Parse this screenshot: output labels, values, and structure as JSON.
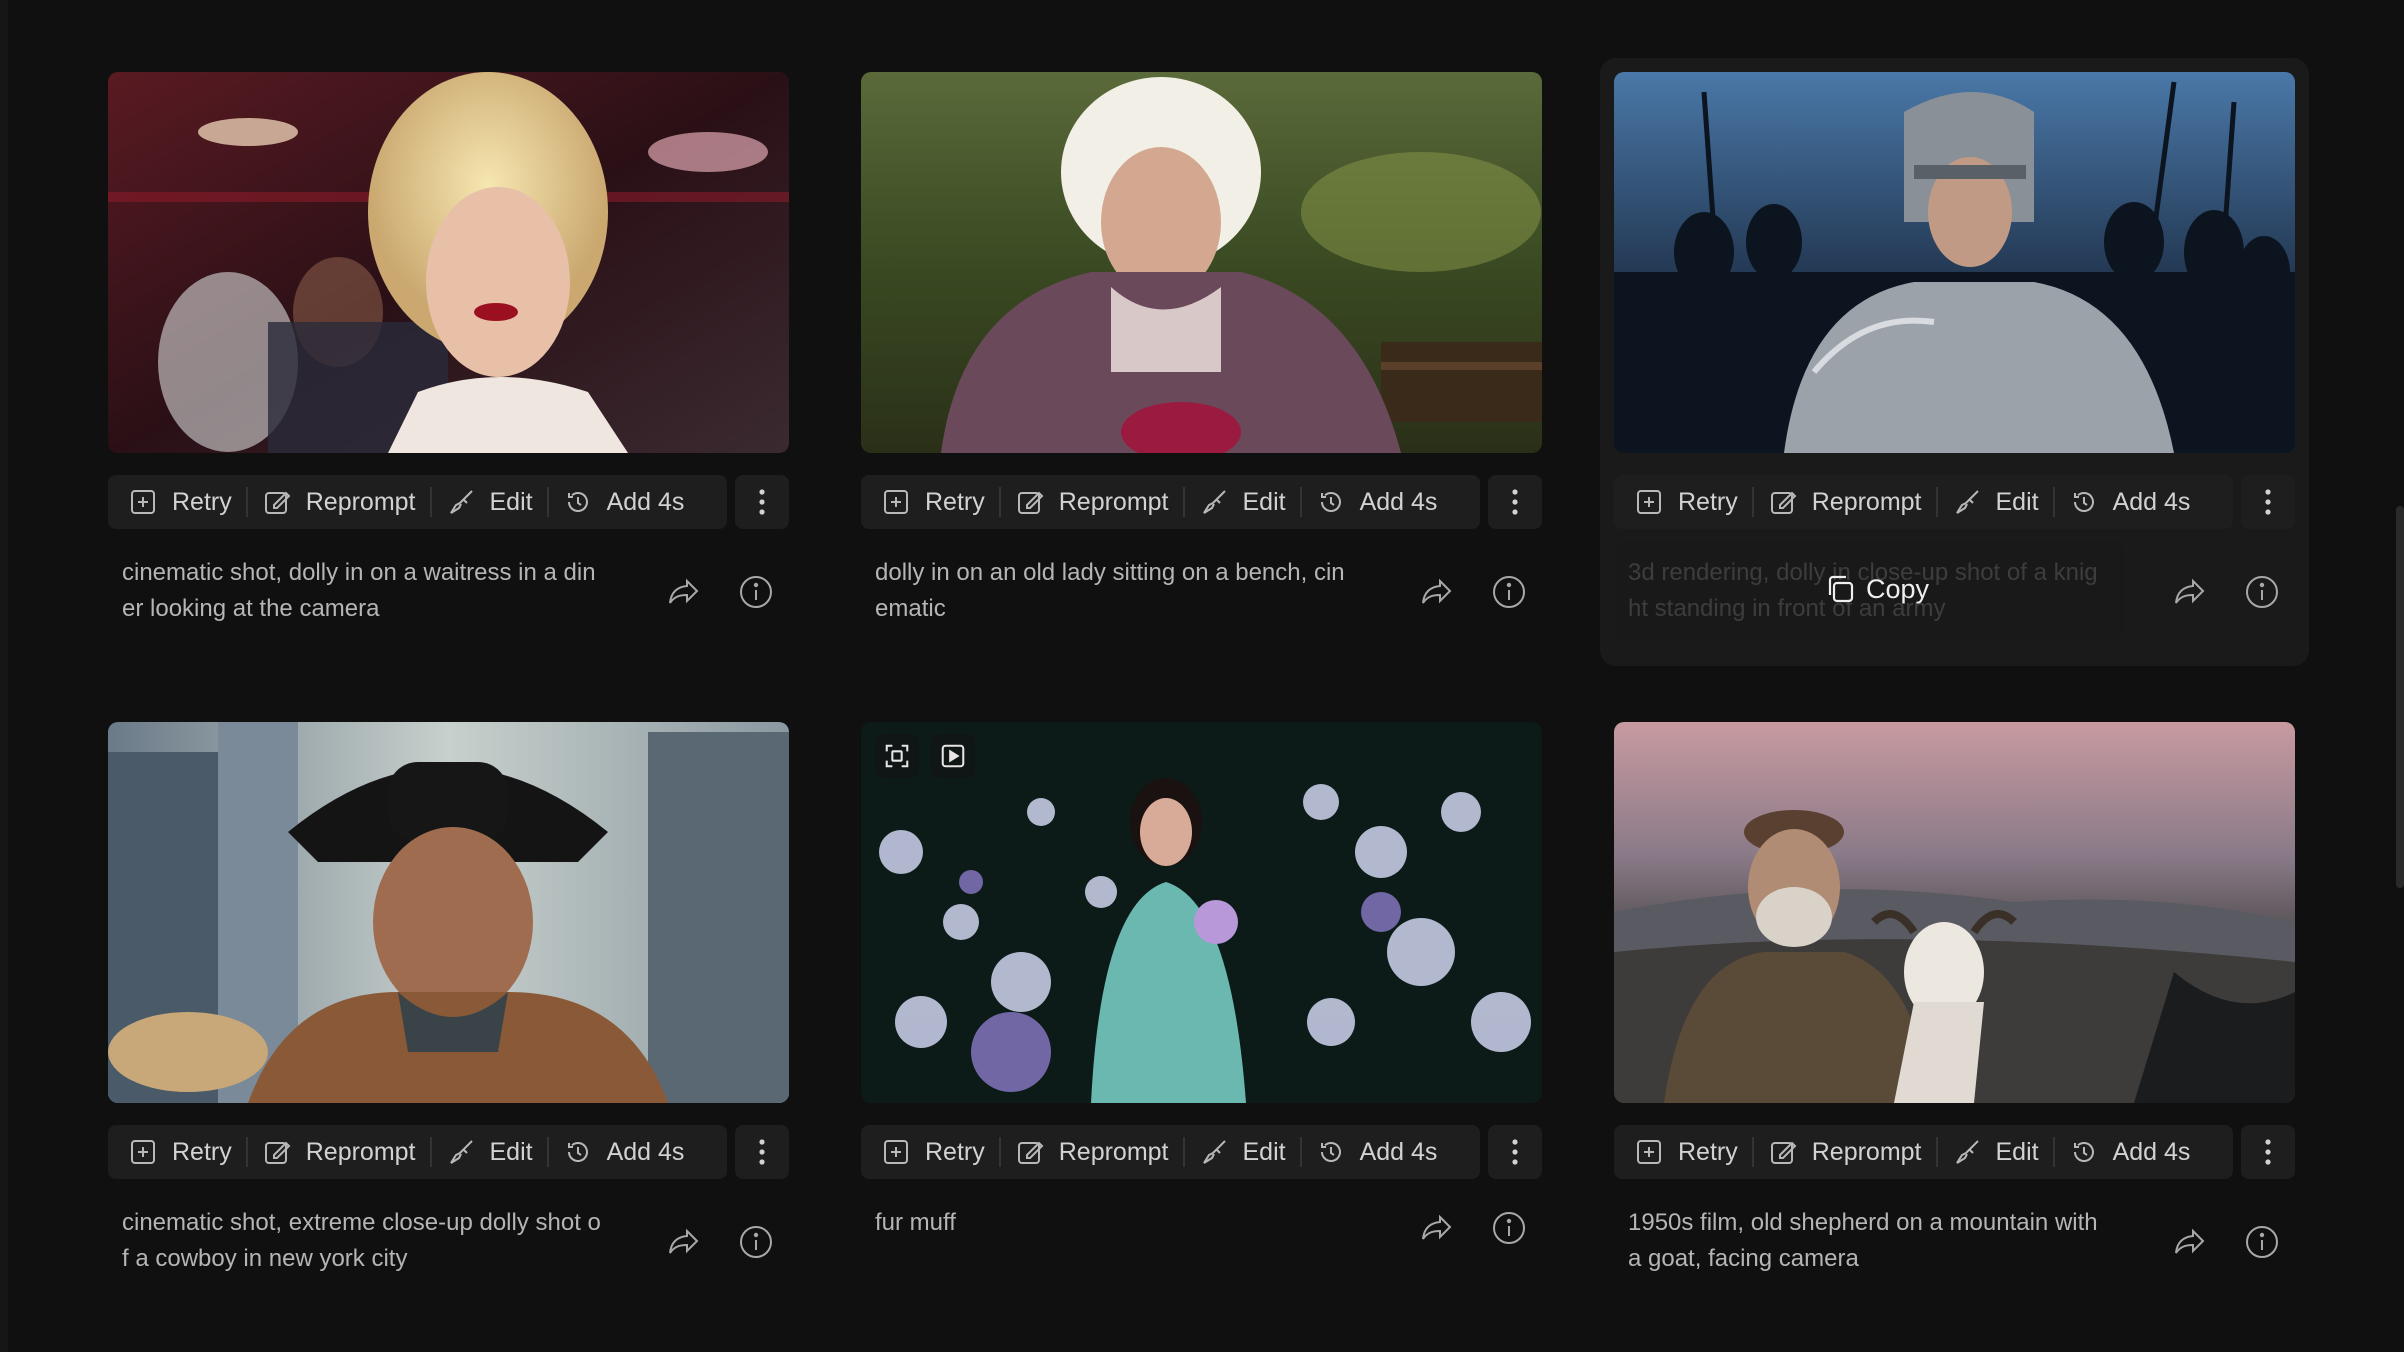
{
  "toolbar": {
    "retry": "Retry",
    "reprompt": "Reprompt",
    "edit": "Edit",
    "add": "Add 4s"
  },
  "copy_label": "Copy",
  "cards": [
    {
      "caption": "cinematic shot, dolly in on a waitress in a diner looking at the camera"
    },
    {
      "caption": "dolly in on an old lady sitting on a bench, cinematic"
    },
    {
      "caption": "3d rendering, dolly in close-up shot of a knight standing in front of an army"
    },
    {
      "caption": "cinematic shot, extreme close-up dolly shot of a cowboy in new york city"
    },
    {
      "caption": "fur muff"
    },
    {
      "caption": "1950s film, old shepherd on a mountain with a goat, facing camera"
    }
  ],
  "colors": {
    "background": "#101010",
    "panel": "#1e1e1e",
    "text": "#b5b5b5"
  }
}
